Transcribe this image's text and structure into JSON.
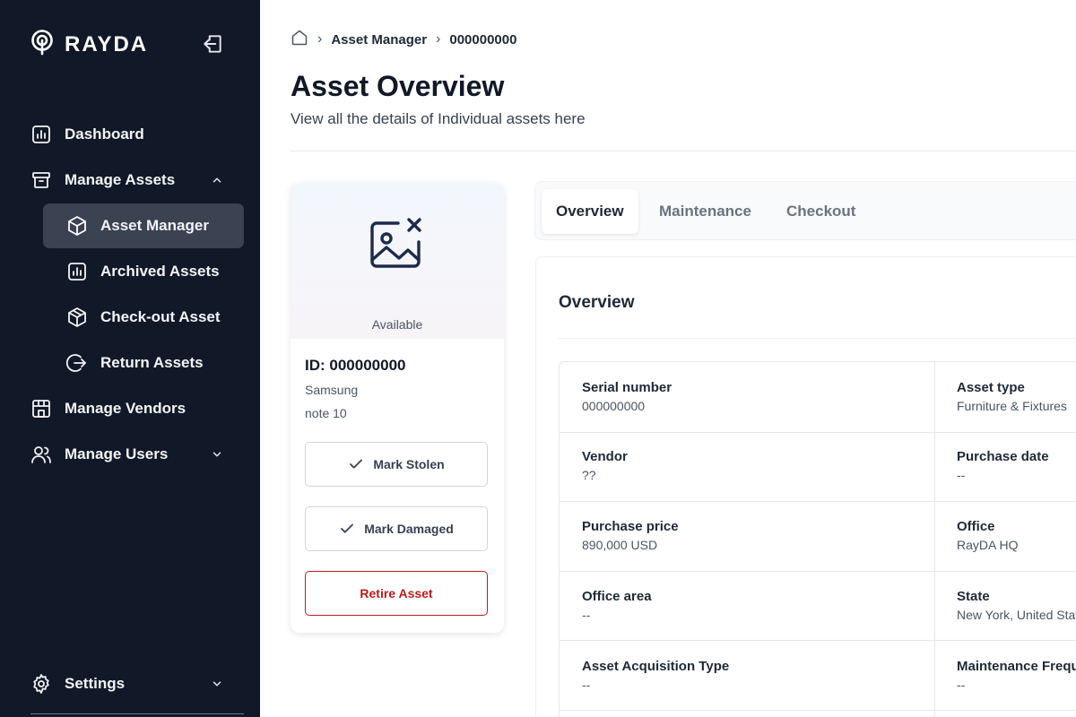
{
  "brand": {
    "name": "RAYDA"
  },
  "sidebar": {
    "items": [
      {
        "label": "Dashboard",
        "icon": "chart-icon"
      },
      {
        "label": "Manage Assets",
        "icon": "archive-box-icon",
        "expanded": true
      },
      {
        "label": "Asset Manager",
        "icon": "cube-icon",
        "active": true
      },
      {
        "label": "Archived Assets",
        "icon": "chart-icon"
      },
      {
        "label": "Check-out Asset",
        "icon": "cube-icon"
      },
      {
        "label": "Return Assets",
        "icon": "return-arrow-icon"
      },
      {
        "label": "Manage Vendors",
        "icon": "store-icon"
      },
      {
        "label": "Manage Users",
        "icon": "users-icon",
        "expanded": false
      },
      {
        "label": "Settings",
        "icon": "gear-icon",
        "expanded": false
      }
    ]
  },
  "breadcrumb": {
    "items": [
      "Asset Manager",
      "000000000"
    ]
  },
  "header": {
    "title": "Asset Overview",
    "subtitle": "View all the details of Individual assets here"
  },
  "asset": {
    "status": "Available",
    "id_label": "ID: 000000000",
    "brand": "Samsung",
    "model": "note 10",
    "actions": {
      "mark_stolen": "Mark Stolen",
      "mark_damaged": "Mark Damaged",
      "retire": "Retire Asset"
    }
  },
  "tabs": [
    {
      "label": "Overview",
      "active": true
    },
    {
      "label": "Maintenance",
      "active": false
    },
    {
      "label": "Checkout",
      "active": false
    }
  ],
  "overview": {
    "heading": "Overview",
    "fields": [
      {
        "label": "Serial number",
        "value": "000000000"
      },
      {
        "label": "Asset type",
        "value": "Furniture & Fixtures"
      },
      {
        "label": "Vendor",
        "value": "??"
      },
      {
        "label": "Purchase date",
        "value": "--"
      },
      {
        "label": "Purchase price",
        "value": "890,000 USD"
      },
      {
        "label": "Office",
        "value": "RayDA HQ"
      },
      {
        "label": "Office area",
        "value": "--"
      },
      {
        "label": "State",
        "value": "New York, United States"
      },
      {
        "label": "Asset Acquisition Type",
        "value": "--"
      },
      {
        "label": "Maintenance Frequency",
        "value": "--"
      }
    ]
  },
  "colors": {
    "sidebar_bg": "#111827",
    "active_item_bg": "#3b4252",
    "danger": "#b91c1c",
    "icon_navy": "#1e2a4a"
  }
}
